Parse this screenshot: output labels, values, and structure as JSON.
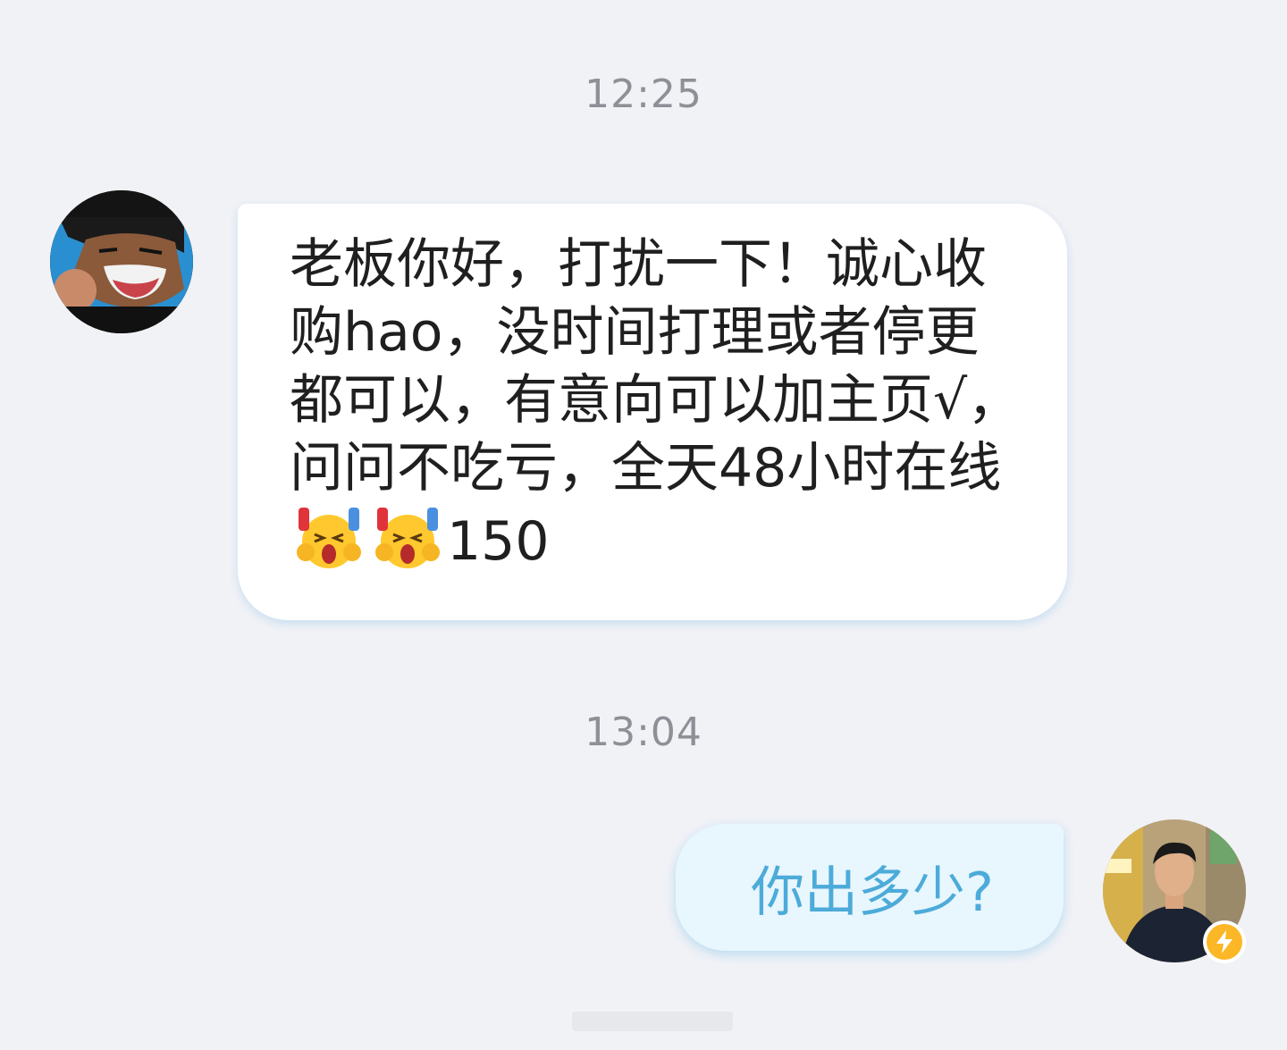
{
  "conversation": {
    "timestamps": [
      "12:25",
      "13:04"
    ],
    "incoming": {
      "sender": "contact",
      "text_before_emoji": "老板你好，打扰一下！诚心收购hao，没时间打理或者停更都可以，有意向可以加主页√，问问不吃亏，全天48小时在线",
      "emoji": "shocked-face-emoji",
      "emoji_count": 2,
      "text_after_emoji": "150"
    },
    "outgoing": {
      "sender": "me",
      "text": "你出多少?"
    }
  },
  "icons": {
    "contact_avatar": "anime-laughing-man-avatar",
    "my_avatar": "man-in-dark-shirt-photo-avatar",
    "badge": "lightning-icon"
  },
  "colors": {
    "background": "#f1f2f6",
    "incoming_bubble": "#ffffff",
    "outgoing_bubble": "#e8f6fd",
    "outgoing_text": "#4cabd9",
    "timestamp_text": "#8d9096",
    "badge": "#fbb725"
  }
}
